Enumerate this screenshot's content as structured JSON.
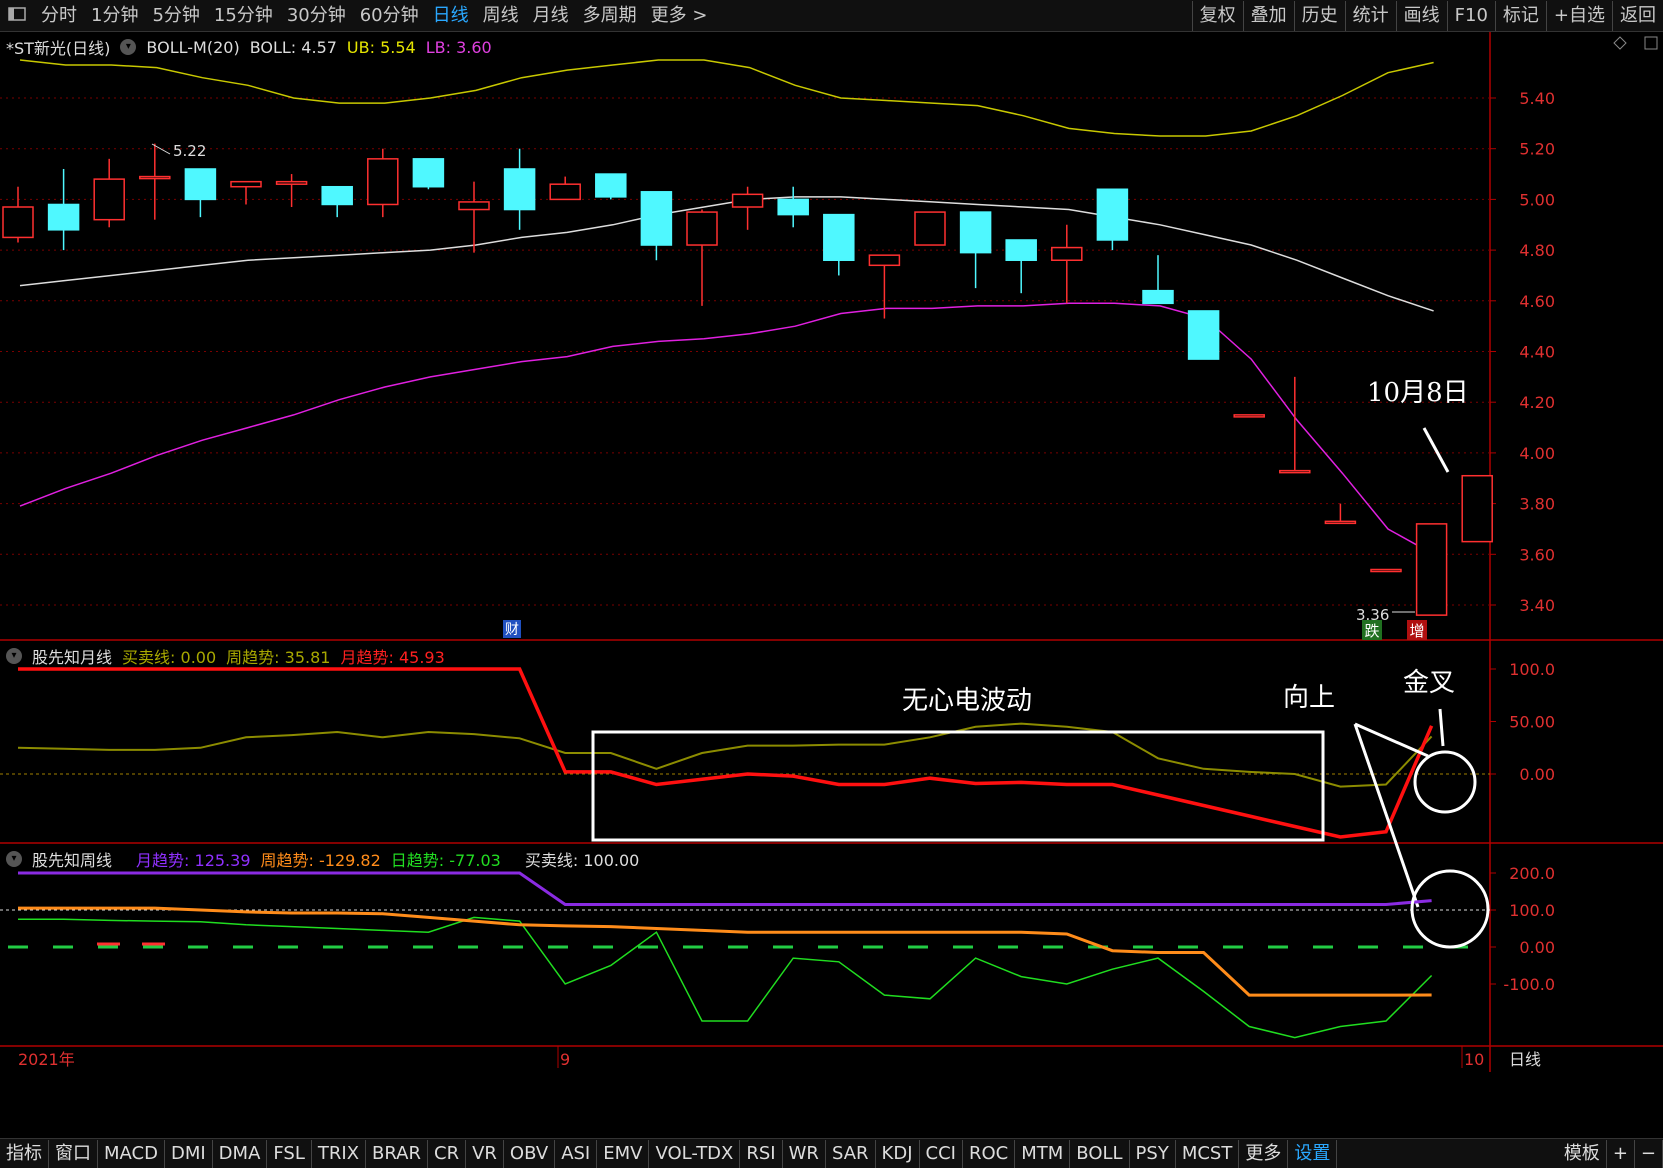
{
  "topbar": {
    "menu_icon": "menu-icon",
    "periods": [
      "分时",
      "1分钟",
      "5分钟",
      "15分钟",
      "30分钟",
      "60分钟",
      "日线",
      "周线",
      "月线",
      "多周期",
      "更多 >"
    ],
    "active_period": "日线",
    "right": [
      "复权",
      "叠加",
      "历史",
      "统计",
      "画线",
      "F10",
      "标记",
      "+自选",
      "返回"
    ]
  },
  "main_panel": {
    "stock": "*ST新光(日线)",
    "indicator": "BOLL-M(20)",
    "boll_label": "BOLL:",
    "boll": "4.57",
    "ub_label": "UB:",
    "ub": "5.54",
    "lb_label": "LB:",
    "lb": "3.60",
    "price_ticks": [
      "5.40",
      "5.20",
      "5.00",
      "4.80",
      "4.60",
      "4.40",
      "4.20",
      "4.00",
      "3.80",
      "3.60",
      "3.40"
    ],
    "high_mark": "5.22",
    "low_mark": "3.36",
    "badge_cai": "财",
    "badge_die": "跌",
    "badge_zeng": "增",
    "note_date": "10月8日"
  },
  "panel2": {
    "name": "股先知月线",
    "l1": "买卖线:",
    "v1": "0.00",
    "l2": "周趋势:",
    "v2": "35.81",
    "l3": "月趋势:",
    "v3": "45.93",
    "ticks": [
      "100.0",
      "50.00",
      "0.00"
    ],
    "note_center": "无心电波动",
    "note_up": "向上",
    "note_cross": "金叉"
  },
  "panel3": {
    "name": "股先知周线",
    "l1": "月趋势:",
    "v1": "125.39",
    "l2": "周趋势:",
    "v2": "-129.82",
    "l3": "日趋势:",
    "v3": "-77.03",
    "l4": "买卖线:",
    "v4": "100.00",
    "ticks": [
      "200.0",
      "100.0",
      "0.00",
      "-100.0"
    ]
  },
  "xaxis": {
    "year": "2021年",
    "m9": "9",
    "m10": "10",
    "period": "日线"
  },
  "bottombar": {
    "items": [
      "指标",
      "窗口",
      "MACD",
      "DMI",
      "DMA",
      "FSL",
      "TRIX",
      "BRAR",
      "CR",
      "VR",
      "OBV",
      "ASI",
      "EMV",
      "VOL-TDX",
      "RSI",
      "WR",
      "SAR",
      "KDJ",
      "CCI",
      "ROC",
      "MTM",
      "BOLL",
      "PSY",
      "MCST",
      "更多",
      "设置"
    ],
    "active": "设置",
    "right": [
      "模板",
      "+",
      "−"
    ]
  },
  "chart_data": {
    "type": "candlestick",
    "ohlc": [
      [
        4.85,
        5.05,
        4.83,
        4.97
      ],
      [
        4.98,
        5.12,
        4.8,
        4.88
      ],
      [
        4.92,
        5.16,
        4.89,
        5.08
      ],
      [
        5.09,
        5.22,
        4.92,
        5.09
      ],
      [
        5.12,
        5.12,
        4.93,
        5.0
      ],
      [
        5.05,
        5.07,
        4.98,
        5.07
      ],
      [
        5.06,
        5.1,
        4.97,
        5.07
      ],
      [
        5.05,
        5.05,
        4.93,
        4.98
      ],
      [
        4.98,
        5.2,
        4.93,
        5.16
      ],
      [
        5.16,
        5.16,
        5.04,
        5.05
      ],
      [
        4.96,
        5.07,
        4.79,
        4.99
      ],
      [
        5.12,
        5.2,
        4.88,
        4.96
      ],
      [
        5.0,
        5.09,
        5.0,
        5.06
      ],
      [
        5.1,
        5.1,
        5.0,
        5.01
      ],
      [
        5.03,
        5.03,
        4.76,
        4.82
      ],
      [
        4.82,
        4.96,
        4.58,
        4.95
      ],
      [
        4.97,
        5.05,
        4.88,
        5.02
      ],
      [
        5.0,
        5.05,
        4.89,
        4.94
      ],
      [
        4.94,
        4.94,
        4.7,
        4.76
      ],
      [
        4.74,
        4.77,
        4.53,
        4.78
      ],
      [
        4.82,
        4.95,
        4.82,
        4.95
      ],
      [
        4.95,
        4.95,
        4.65,
        4.79
      ],
      [
        4.84,
        4.84,
        4.63,
        4.76
      ],
      [
        4.76,
        4.9,
        4.59,
        4.81
      ],
      [
        5.04,
        5.04,
        4.8,
        4.84
      ],
      [
        4.64,
        4.78,
        4.59,
        4.59
      ],
      [
        4.56,
        4.56,
        4.37,
        4.37
      ],
      [
        4.15,
        4.15,
        4.15,
        4.15
      ],
      [
        3.93,
        4.3,
        3.93,
        3.93
      ],
      [
        3.73,
        3.8,
        3.73,
        3.73
      ],
      [
        3.54,
        3.54,
        3.54,
        3.54
      ],
      [
        3.36,
        3.72,
        3.36,
        3.72
      ],
      [
        3.65,
        3.91,
        3.65,
        3.91
      ]
    ],
    "boll_mid": [
      4.66,
      4.68,
      4.7,
      4.72,
      4.74,
      4.76,
      4.77,
      4.78,
      4.79,
      4.8,
      4.82,
      4.85,
      4.87,
      4.9,
      4.94,
      4.97,
      5.0,
      5.01,
      5.01,
      5.0,
      4.99,
      4.98,
      4.97,
      4.96,
      4.93,
      4.9,
      4.86,
      4.82,
      4.76,
      4.69,
      4.62,
      4.56
    ],
    "boll_ub": [
      5.55,
      5.53,
      5.53,
      5.52,
      5.48,
      5.45,
      5.4,
      5.38,
      5.38,
      5.4,
      5.43,
      5.48,
      5.51,
      5.53,
      5.55,
      5.55,
      5.52,
      5.45,
      5.4,
      5.39,
      5.38,
      5.37,
      5.33,
      5.28,
      5.26,
      5.25,
      5.25,
      5.27,
      5.33,
      5.41,
      5.5,
      5.54
    ],
    "boll_lb": [
      3.79,
      3.86,
      3.92,
      3.99,
      4.05,
      4.1,
      4.15,
      4.21,
      4.26,
      4.3,
      4.33,
      4.36,
      4.38,
      4.42,
      4.44,
      4.45,
      4.47,
      4.5,
      4.55,
      4.57,
      4.57,
      4.58,
      4.58,
      4.59,
      4.59,
      4.58,
      4.53,
      4.37,
      4.13,
      3.92,
      3.7,
      3.6
    ],
    "p2_month": [
      100,
      100,
      100,
      100,
      100,
      100,
      100,
      100,
      100,
      100,
      100,
      100,
      2,
      2,
      -10,
      -5,
      0,
      -2,
      -10,
      -10,
      -4,
      -9,
      -8,
      -10,
      -10,
      -20,
      -30,
      -40,
      -50,
      -60,
      -55,
      45.93
    ],
    "p2_week": [
      25,
      24,
      23,
      23,
      25,
      35,
      37,
      40,
      35,
      40,
      38,
      34,
      20,
      20,
      5,
      20,
      27,
      27,
      28,
      28,
      35,
      45,
      48,
      45,
      40,
      15,
      5,
      2,
      0,
      -12,
      -10,
      35.81
    ],
    "p3_month": [
      200,
      200,
      200,
      200,
      200,
      200,
      200,
      200,
      200,
      200,
      200,
      200,
      115,
      115,
      115,
      115,
      115,
      115,
      115,
      115,
      115,
      115,
      115,
      115,
      115,
      115,
      115,
      115,
      115,
      115,
      115,
      125.39
    ],
    "p3_week": [
      105,
      105,
      105,
      105,
      100,
      95,
      92,
      92,
      90,
      80,
      70,
      60,
      57,
      55,
      50,
      45,
      40,
      40,
      40,
      40,
      40,
      40,
      40,
      35,
      -10,
      -15,
      -15,
      -130,
      -130,
      -130,
      -130,
      -129.82
    ],
    "p3_day": [
      75,
      75,
      72,
      70,
      68,
      60,
      55,
      50,
      45,
      40,
      80,
      70,
      -100,
      -50,
      40,
      -200,
      -200,
      -30,
      -40,
      -130,
      -140,
      -30,
      -80,
      -100,
      -60,
      -30,
      -120,
      -215,
      -245,
      -215,
      -200,
      -77.03
    ]
  }
}
